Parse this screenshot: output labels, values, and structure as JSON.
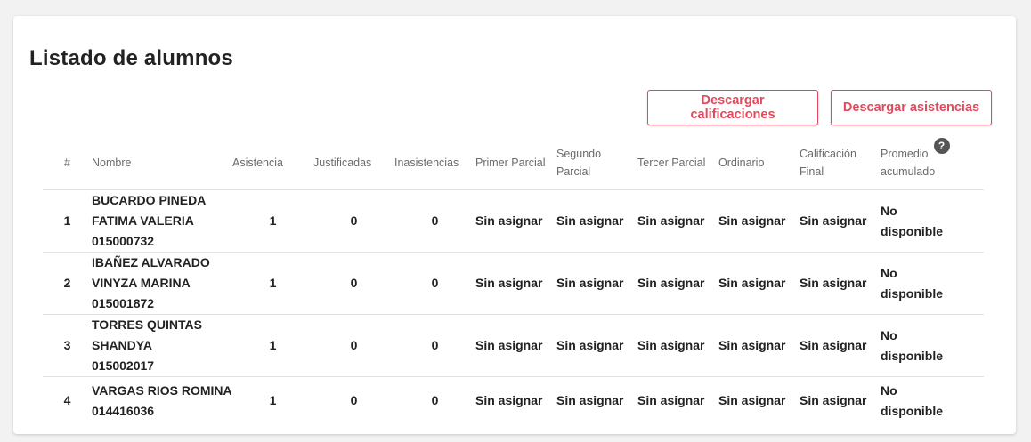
{
  "title": "Listado de alumnos",
  "buttons": {
    "download_grades": "Descargar calificaciones",
    "download_attendance": "Descargar asistencias"
  },
  "columns": {
    "num": "#",
    "nombre": "Nombre",
    "asistencia": "Asistencia",
    "justificadas": "Justificadas",
    "inasistencias": "Inasistencias",
    "primer": "Primer Parcial",
    "segundo": "Segundo Parcial",
    "tercer": "Tercer Parcial",
    "ordinario": "Ordinario",
    "calificacion_line1": "Calificación",
    "calificacion_line2": "Final",
    "promedio_line1": "Promedio",
    "promedio_line2": "acumulado",
    "help_icon": "?"
  },
  "rows": [
    {
      "num": "1",
      "name_lines": [
        "BUCARDO PINEDA",
        "FATIMA VALERIA",
        "015000732"
      ],
      "asistencia": "1",
      "justificadas": "0",
      "inasistencias": "0",
      "primer": "Sin asignar",
      "segundo": "Sin asignar",
      "tercer": "Sin asignar",
      "ordinario": "Sin asignar",
      "final": "Sin asignar",
      "promedio_line1": "No",
      "promedio_line2": "disponible"
    },
    {
      "num": "2",
      "name_lines": [
        "IBAÑEZ ALVARADO",
        "VINYZA MARINA",
        "015001872"
      ],
      "asistencia": "1",
      "justificadas": "0",
      "inasistencias": "0",
      "primer": "Sin asignar",
      "segundo": "Sin asignar",
      "tercer": "Sin asignar",
      "ordinario": "Sin asignar",
      "final": "Sin asignar",
      "promedio_line1": "No",
      "promedio_line2": "disponible"
    },
    {
      "num": "3",
      "name_lines": [
        "TORRES QUINTAS",
        "SHANDYA",
        "015002017"
      ],
      "asistencia": "1",
      "justificadas": "0",
      "inasistencias": "0",
      "primer": "Sin asignar",
      "segundo": "Sin asignar",
      "tercer": "Sin asignar",
      "ordinario": "Sin asignar",
      "final": "Sin asignar",
      "promedio_line1": "No",
      "promedio_line2": "disponible"
    },
    {
      "num": "4",
      "name_lines": [
        "VARGAS RIOS ROMINA",
        "014416036"
      ],
      "asistencia": "1",
      "justificadas": "0",
      "inasistencias": "0",
      "primer": "Sin asignar",
      "segundo": "Sin asignar",
      "tercer": "Sin asignar",
      "ordinario": "Sin asignar",
      "final": "Sin asignar",
      "promedio_line1": "No",
      "promedio_line2": "disponible"
    }
  ]
}
